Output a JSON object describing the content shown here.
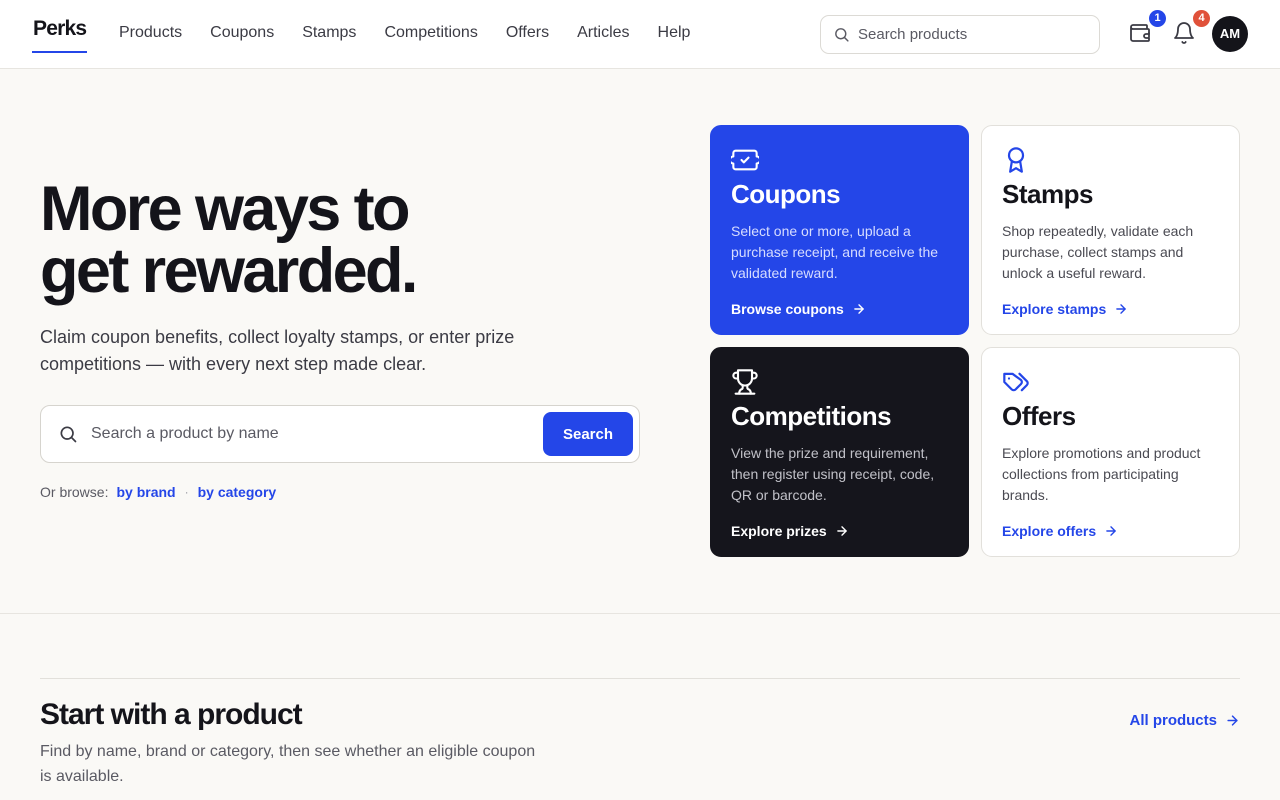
{
  "header": {
    "logo": "Perks",
    "nav": [
      {
        "label": "Products"
      },
      {
        "label": "Coupons"
      },
      {
        "label": "Stamps"
      },
      {
        "label": "Competitions"
      },
      {
        "label": "Offers"
      },
      {
        "label": "Articles"
      },
      {
        "label": "Help"
      }
    ],
    "search_placeholder": "Search products",
    "wallet_badge": "1",
    "notifications_badge": "4",
    "avatar_initials": "AM"
  },
  "hero": {
    "title_line1": "More ways to",
    "title_line2": "get rewarded.",
    "subtitle": "Claim coupon benefits, collect loyalty stamps, or enter prize competitions — with every next step made clear.",
    "search_placeholder": "Search a product by name",
    "search_button": "Search",
    "browse_label": "Or browse:",
    "browse_brand": "by brand",
    "browse_separator": "·",
    "browse_category": "by category"
  },
  "cards": [
    {
      "title": "Coupons",
      "description": "Select one or more, upload a purchase receipt, and receive the validated reward.",
      "link": "Browse coupons",
      "icon": "ticket-icon"
    },
    {
      "title": "Stamps",
      "description": "Shop repeatedly, validate each purchase, collect stamps and unlock a useful reward.",
      "link": "Explore stamps",
      "icon": "award-icon"
    },
    {
      "title": "Competitions",
      "description": "View the prize and requirement, then register using receipt, code, QR or barcode.",
      "link": "Explore prizes",
      "icon": "trophy-icon"
    },
    {
      "title": "Offers",
      "description": "Explore promotions and product collections from participating brands.",
      "link": "Explore offers",
      "icon": "tag-icon"
    }
  ],
  "section": {
    "title": "Start with a product",
    "subtitle": "Find by name, brand or category, then see whether an eligible coupon is available.",
    "link": "All products"
  },
  "colors": {
    "accent": "#2446e8",
    "dark_card": "#15151c",
    "background": "#faf9f6",
    "badge_wallet": "#2446e8",
    "badge_notifications": "#e0513a"
  }
}
